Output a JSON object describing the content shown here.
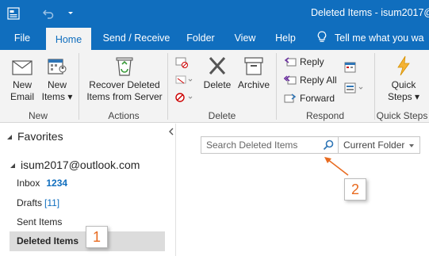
{
  "window": {
    "title": "Deleted Items - isum2017@o"
  },
  "tabs": [
    {
      "label": "File",
      "active": false
    },
    {
      "label": "Home",
      "active": true
    },
    {
      "label": "Send / Receive",
      "active": false
    },
    {
      "label": "Folder",
      "active": false
    },
    {
      "label": "View",
      "active": false
    },
    {
      "label": "Help",
      "active": false
    }
  ],
  "tell_me": {
    "label": "Tell me what you wa"
  },
  "ribbon": {
    "new": {
      "group_label": "New",
      "new_email": [
        "New",
        "Email"
      ],
      "new_items": [
        "New",
        "Items ▾"
      ]
    },
    "actions": {
      "group_label": "Actions",
      "recover": [
        "Recover Deleted",
        "Items from Server"
      ]
    },
    "delete": {
      "group_label": "Delete",
      "delete_label": "Delete",
      "archive_label": "Archive"
    },
    "respond": {
      "group_label": "Respond",
      "reply": "Reply",
      "reply_all": "Reply All",
      "forward": "Forward"
    },
    "quick_steps": {
      "group_label": "Quick Steps",
      "label": [
        "Quick",
        "Steps ▾"
      ]
    }
  },
  "nav": {
    "favorites": "Favorites",
    "account": "isum2017@outlook.com",
    "folders": [
      {
        "name": "Inbox",
        "count": "1234"
      },
      {
        "name": "Drafts",
        "count": "[11]"
      },
      {
        "name": "Sent Items",
        "count": ""
      },
      {
        "name": "Deleted Items",
        "count": ""
      }
    ]
  },
  "search": {
    "placeholder": "Search Deleted Items",
    "scope": "Current Folder"
  },
  "callouts": {
    "one": "1",
    "two": "2"
  },
  "colors": {
    "accent": "#106ebe",
    "callout": "#e86a1f"
  }
}
